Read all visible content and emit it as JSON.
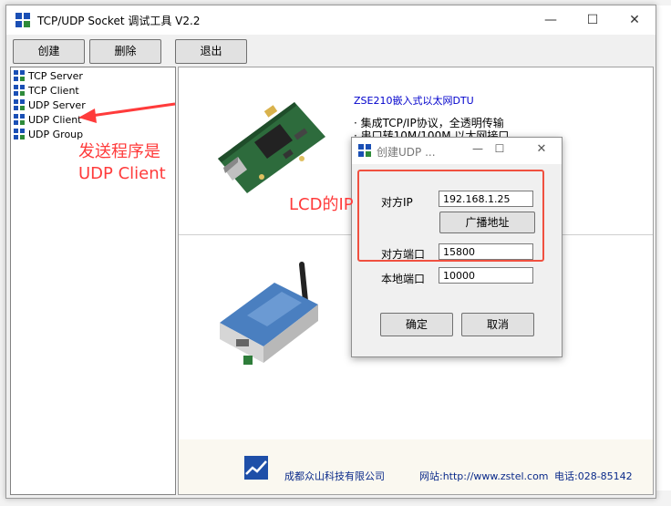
{
  "app": {
    "title": "TCP/UDP Socket 调试工具 V2.2",
    "controls": {
      "minimize": "—",
      "maximize": "☐",
      "close": "✕"
    }
  },
  "toolbar": {
    "create": "创建",
    "delete": "删除",
    "exit": "退出"
  },
  "tree": {
    "items": [
      {
        "label": "TCP Server"
      },
      {
        "label": "TCP Client"
      },
      {
        "label": "UDP Server"
      },
      {
        "label": "UDP Client"
      },
      {
        "label": "UDP Group"
      }
    ]
  },
  "product": {
    "title": "ZSE210嵌入式以太网DTU",
    "bullets": [
      "· 集成TCP/IP协议，全透明传输",
      "· 串口转10M/100M 以太网接口"
    ]
  },
  "footer": {
    "company": "成都众山科技有限公司",
    "website": "网站:http://www.zstel.com",
    "phone": "电话:028-85142"
  },
  "dialog": {
    "title": "创建UDP ...",
    "controls": {
      "minimize": "—",
      "maximize": "☐",
      "close": "✕"
    },
    "remote_ip_label": "对方IP",
    "remote_ip_value": "192.168.1.25",
    "broadcast_button": "广播地址",
    "remote_port_label": "对方端口",
    "remote_port_value": "15800",
    "local_port_label": "本地端口",
    "local_port_value": "10000",
    "ok_button": "确定",
    "cancel_button": "取消"
  },
  "annotations": {
    "sender_line1": "发送程序是",
    "sender_line2": "UDP Client",
    "lcd_ip": "LCD的IP",
    "color": "#ff3b3b"
  }
}
